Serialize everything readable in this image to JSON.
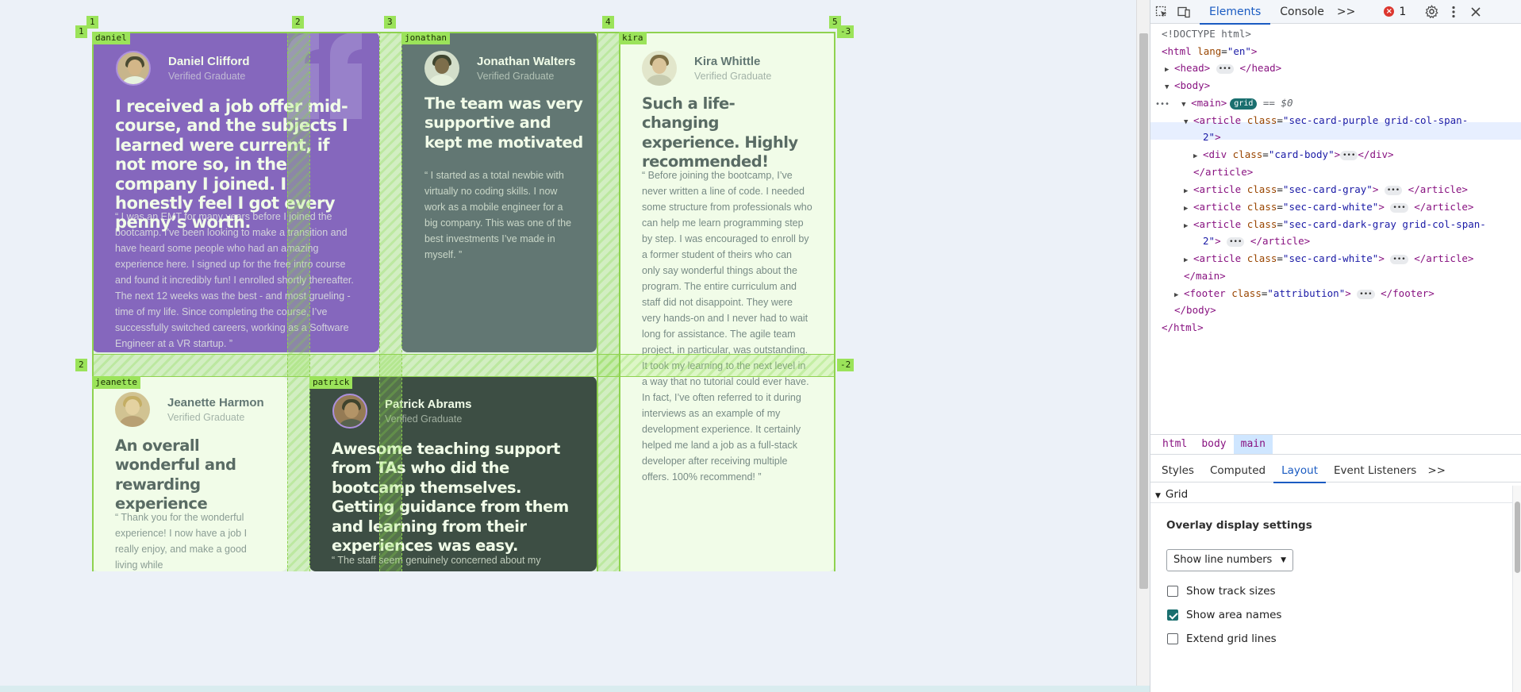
{
  "cards": [
    {
      "area": "daniel",
      "name": "Daniel Clifford",
      "role": "Verified Graduate",
      "headline": "I received a job offer mid-course, and the subjects I learned were current, if not more so, in the company I joined. I honestly feel I got every penny’s worth.",
      "quote": "“ I was an EMT for many years before I joined the bootcamp. I’ve been looking to make a transition and have heard some people who had an amazing experience here. I signed up for the free intro course and found it incredibly fun! I enrolled shortly thereafter. The next 12 weeks was the best - and most grueling - time of my life. Since completing the course, I’ve successfully switched careers, working as a Software Engineer at a VR startup. ”"
    },
    {
      "area": "jonathan",
      "name": "Jonathan Walters",
      "role": "Verified Graduate",
      "headline": "The team was very supportive and kept me motivated",
      "quote": "“ I started as a total newbie with virtually no coding skills. I now work as a mobile engineer for a big company. This was one of the best investments I’ve made in myself. ”"
    },
    {
      "area": "kira",
      "name": "Kira Whittle",
      "role": "Verified Graduate",
      "headline": "Such a life-changing experience. Highly recommended!",
      "quote": "“ Before joining the bootcamp, I’ve never written a line of code. I needed some structure from professionals who can help me learn programming step by step. I was encouraged to enroll by a former student of theirs who can only say wonderful things about the program. The entire curriculum and staff did not disappoint. They were very hands-on and I never had to wait long for assistance. The agile team project, in particular, was outstanding. It took my learning to the next level in a way that no tutorial could ever have. In fact, I’ve often referred to it during interviews as an example of my development experience. It certainly helped me land a job as a full-stack developer after receiving multiple offers. 100% recommend! ”"
    },
    {
      "area": "jeanette",
      "name": "Jeanette Harmon",
      "role": "Verified Graduate",
      "headline": "An overall wonderful and rewarding experience",
      "quote": "“ Thank you for the wonderful experience! I now have a job I really enjoy, and make a good living while"
    },
    {
      "area": "patrick",
      "name": "Patrick Abrams",
      "role": "Verified Graduate",
      "headline": "Awesome teaching support from TAs who did the bootcamp themselves. Getting guidance from them and learning from their experiences was easy.",
      "quote": "“ The staff seem genuinely concerned about my progress"
    }
  ],
  "grid_overlay": {
    "column_numbers": [
      "1",
      "2",
      "3",
      "4",
      "5"
    ],
    "row_numbers_left": [
      "1",
      "2"
    ],
    "row_numbers_right": [
      "-3",
      "-2"
    ]
  },
  "devtools": {
    "tabs": [
      "Elements",
      "Console"
    ],
    "more": ">>",
    "error_count": "1",
    "dom": {
      "doctype": "<!DOCTYPE html>",
      "html_open": "<html",
      "lang_attr": "lang",
      "lang_val": "\"en\"",
      "head": "<head>",
      "head_close": "</head>",
      "body": "<body>",
      "main": "<main>",
      "grid_badge": "grid",
      "eq": "== $0",
      "article1_class": "\"sec-card-purple grid-col-span-",
      "article1_class_cont": "2\"",
      "div_class": "\"card-body\"",
      "article_close": "</article>",
      "article2_class": "\"sec-card-gray\"",
      "article3_class": "\"sec-card-white\"",
      "article4_class": "\"sec-card-dark-gray grid-col-span-",
      "article4_class_cont": "2\"",
      "article5_class": "\"sec-card-white\"",
      "main_close": "</main>",
      "footer_class": "\"attribution\"",
      "body_close": "</body>",
      "html_close": "</html>"
    },
    "breadcrumbs": [
      "html",
      "body",
      "main"
    ],
    "panel_tabs": [
      "Styles",
      "Computed",
      "Layout",
      "Event Listeners"
    ],
    "section_title": "Grid",
    "overlay_title": "Overlay display settings",
    "select_value": "Show line numbers",
    "checkboxes": [
      {
        "label": "Show track sizes",
        "checked": false
      },
      {
        "label": "Show area names",
        "checked": true
      },
      {
        "label": "Extend grid lines",
        "checked": false
      }
    ]
  },
  "colors": {
    "purple": "#7541c8",
    "gray": "#48556a",
    "white": "#ffffff",
    "dark": "#19212e",
    "overlay_green": "#9be35a"
  }
}
